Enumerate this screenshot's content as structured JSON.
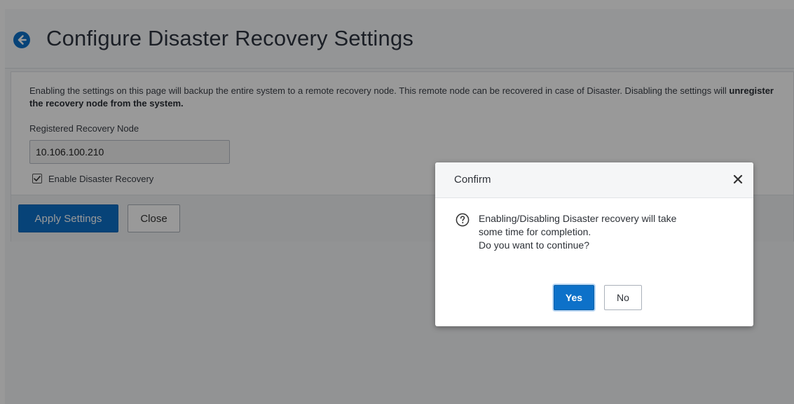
{
  "page": {
    "title": "Configure Disaster Recovery Settings",
    "description_text": "Enabling the settings on this page will backup the entire system to a remote recovery node. This remote node can be recovered in case of Disaster. Disabling the settings will ",
    "description_bold": "unregister the recovery node from the system.",
    "field_label": "Registered Recovery Node",
    "field_value": "10.106.100.210",
    "checkbox_label": "Enable Disaster Recovery",
    "checkbox_checked": true,
    "apply_button": "Apply Settings",
    "close_button": "Close"
  },
  "dialog": {
    "title": "Confirm",
    "message_lines": [
      "Enabling/Disabling Disaster recovery will take",
      "some time for completion.",
      "Do you want to continue?"
    ],
    "yes_button": "Yes",
    "no_button": "No"
  },
  "icons": {
    "back": "back-arrow-icon",
    "close": "close-icon",
    "question": "question-circle-icon",
    "checkbox": "checkbox-checked-icon"
  },
  "colors": {
    "accent": "#0d71c9",
    "overlay": "#000000"
  }
}
